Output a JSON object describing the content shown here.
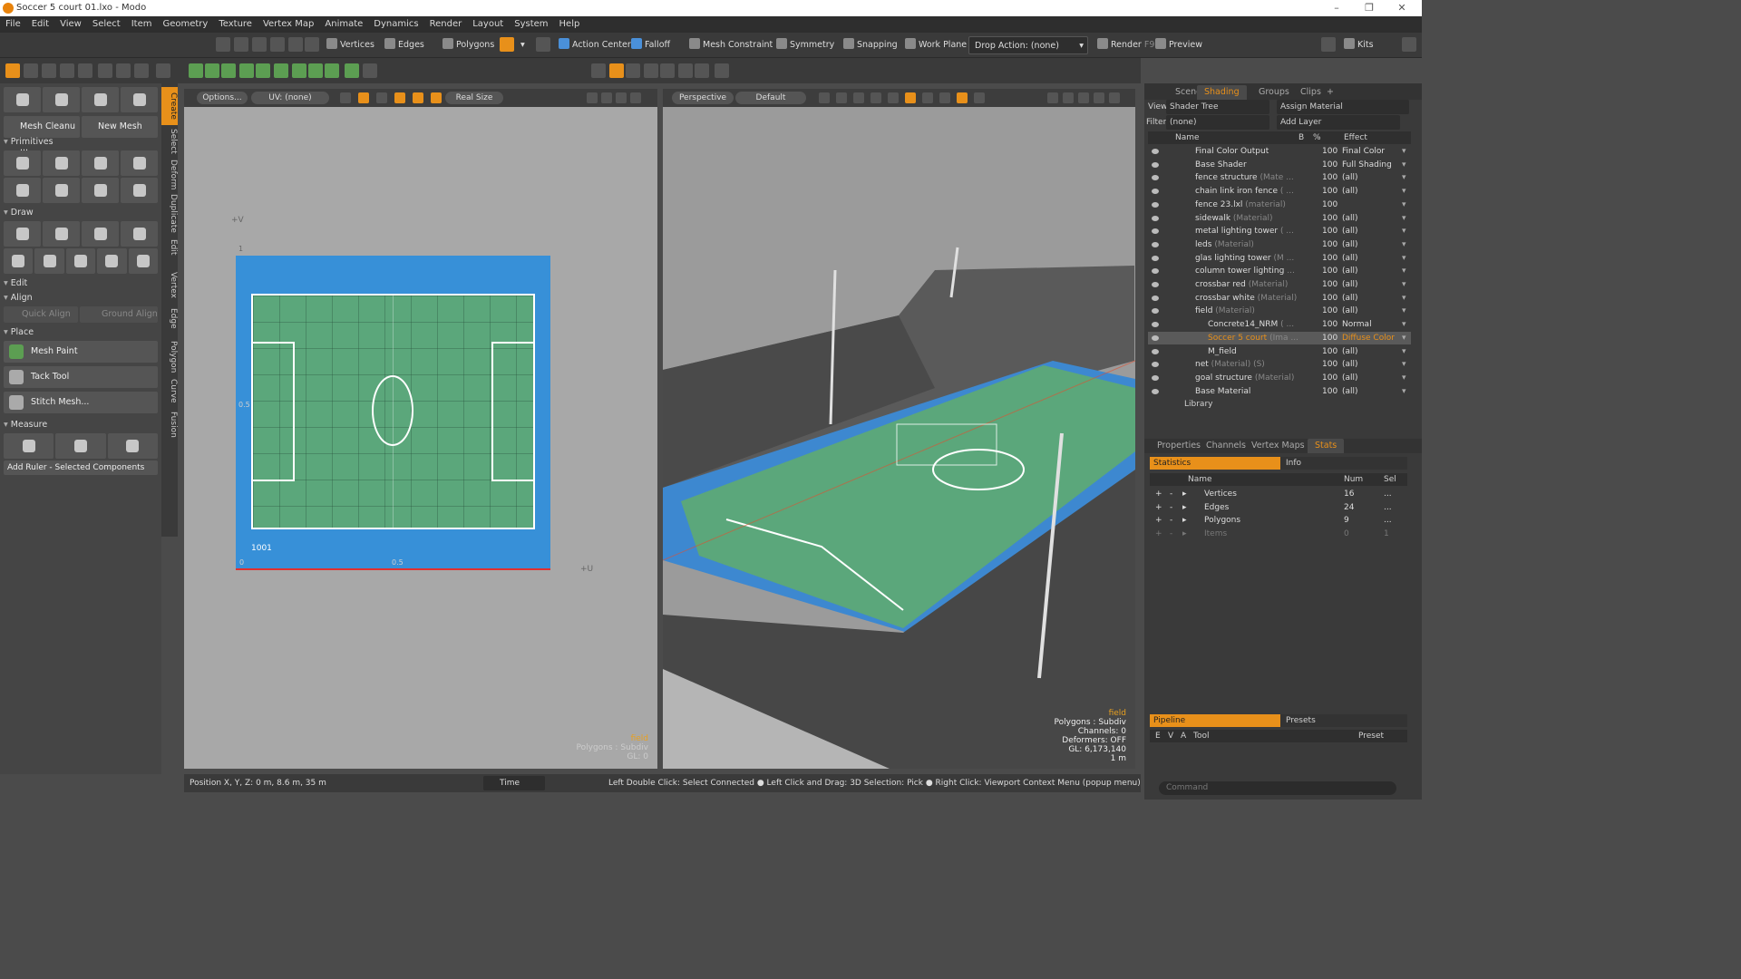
{
  "window": {
    "title": "Soccer 5 court 01.lxo - Modo"
  },
  "menu": [
    "File",
    "Edit",
    "View",
    "Select",
    "Item",
    "Geometry",
    "Texture",
    "Vertex Map",
    "Animate",
    "Dynamics",
    "Render",
    "Layout",
    "System",
    "Help"
  ],
  "toolbar": {
    "vertices": "Vertices",
    "edges": "Edges",
    "polygons": "Polygons",
    "action_center": "Action Center",
    "falloff": "Falloff",
    "mesh_constraint": "Mesh Constraint",
    "symmetry": "Symmetry",
    "snapping": "Snapping",
    "work_plane": "Work Plane",
    "drop_action": "Drop Action: (none)",
    "render": "Render",
    "render_key": "F9",
    "preview": "Preview",
    "kits": "Kits"
  },
  "left": {
    "mesh_cleanup": "Mesh Cleanu ...",
    "new_mesh": "New Mesh",
    "primitives": "Primitives",
    "draw": "Draw",
    "edit": "Edit",
    "align": "Align",
    "quick_align": "Quick Align",
    "ground_align": "Ground Align",
    "place": "Place",
    "mesh_paint": "Mesh Paint",
    "tack_tool": "Tack Tool",
    "stitch_mesh": "Stitch Mesh...",
    "measure": "Measure",
    "add_ruler": "Add Ruler - Selected Components",
    "vtabs": [
      "Create",
      "Select",
      "Deform",
      "Duplicate",
      "Edit",
      "Vertex",
      "Edge",
      "Polygon",
      "Curve",
      "Fusion"
    ]
  },
  "uv": {
    "options": "Options...",
    "uvmap": "UV: (none)",
    "real_size": "Real Size",
    "plus_v": "+V",
    "plus_u": "+U",
    "one": "1",
    "zero": "0",
    "half": "0.5",
    "half_v": "0.5",
    "tile": "1001",
    "overlay": [
      "field",
      "Polygons : Subdiv",
      "GL: 0"
    ]
  },
  "vp3d": {
    "perspective": "Perspective",
    "default": "Default",
    "overlay": [
      "field",
      "Polygons : Subdiv",
      "Channels: 0",
      "Deformers: OFF",
      "GL: 6,173,140",
      "1 m"
    ]
  },
  "shading": {
    "tabs": [
      "Scenes",
      "Shading",
      "Groups",
      "Clips"
    ],
    "view_label": "View",
    "view": "Shader Tree",
    "assign": "Assign Material",
    "filter_label": "Filter",
    "filter": "(none)",
    "add_layer": "Add Layer",
    "cols": {
      "name": "Name",
      "b": "B",
      "pct": "%",
      "effect": "Effect"
    },
    "rows": [
      {
        "name": "Final Color Output",
        "sub": "",
        "pct": "100",
        "effect": "Final Color"
      },
      {
        "name": "Base Shader",
        "sub": "",
        "pct": "100",
        "effect": "Full Shading"
      },
      {
        "name": "fence structure",
        "sub": " (Mate ...",
        "pct": "100",
        "effect": "(all)"
      },
      {
        "name": "chain link iron fence",
        "sub": " ( ...",
        "pct": "100",
        "effect": "(all)"
      },
      {
        "name": "fence 23.lxl",
        "sub": " (material)",
        "pct": "100",
        "effect": ""
      },
      {
        "name": "sidewalk",
        "sub": " (Material)",
        "pct": "100",
        "effect": "(all)"
      },
      {
        "name": "metal lighting tower",
        "sub": " ( ...",
        "pct": "100",
        "effect": "(all)"
      },
      {
        "name": "leds",
        "sub": " (Material)",
        "pct": "100",
        "effect": "(all)"
      },
      {
        "name": "glas lighting tower",
        "sub": " (M ...",
        "pct": "100",
        "effect": "(all)"
      },
      {
        "name": "column tower lighting",
        "sub": " ...",
        "pct": "100",
        "effect": "(all)"
      },
      {
        "name": "crossbar red",
        "sub": " (Material)",
        "pct": "100",
        "effect": "(all)"
      },
      {
        "name": "crossbar white",
        "sub": " (Material)",
        "pct": "100",
        "effect": "(all)"
      },
      {
        "name": "field",
        "sub": " (Material)",
        "pct": "100",
        "effect": "(all)"
      },
      {
        "name": "Concrete14_NRM",
        "sub": " ( ...",
        "pct": "100",
        "effect": "Normal"
      },
      {
        "name": "Soccer 5 court",
        "sub": " (Ima ...",
        "pct": "100",
        "effect": "Diffuse Color"
      },
      {
        "name": "M_field",
        "sub": "",
        "pct": "100",
        "effect": "(all)"
      },
      {
        "name": "net",
        "sub": " (Material) (S)",
        "pct": "100",
        "effect": "(all)"
      },
      {
        "name": "goal structure",
        "sub": " (Material)",
        "pct": "100",
        "effect": "(all)"
      },
      {
        "name": "Base Material",
        "sub": "",
        "pct": "100",
        "effect": "(all)"
      }
    ],
    "library": "Library"
  },
  "props": {
    "tabs": [
      "Properties",
      "Channels",
      "Vertex Maps",
      "Stats"
    ],
    "statistics": "Statistics",
    "info": "Info",
    "cols": {
      "name": "Name",
      "num": "Num",
      "sel": "Sel"
    },
    "rows": [
      {
        "name": "Vertices",
        "num": "16",
        "sel": "..."
      },
      {
        "name": "Edges",
        "num": "24",
        "sel": "..."
      },
      {
        "name": "Polygons",
        "num": "9",
        "sel": "..."
      },
      {
        "name": "Items",
        "num": "0",
        "sel": "1"
      }
    ]
  },
  "pipeline": {
    "pipeline": "Pipeline",
    "presets": "Presets",
    "cols": [
      "E",
      "V",
      "A",
      "Tool",
      "Preset"
    ]
  },
  "status": {
    "pos": "Position X, Y, Z:  0 m, 8.6 m, 35 m",
    "time": "Time",
    "hint": "Left Double Click: Select Connected ● Left Click and Drag: 3D Selection: Pick ● Right Click: Viewport Context Menu (popup menu) ● Right Click ..."
  },
  "command": {
    "placeholder": "Command"
  }
}
